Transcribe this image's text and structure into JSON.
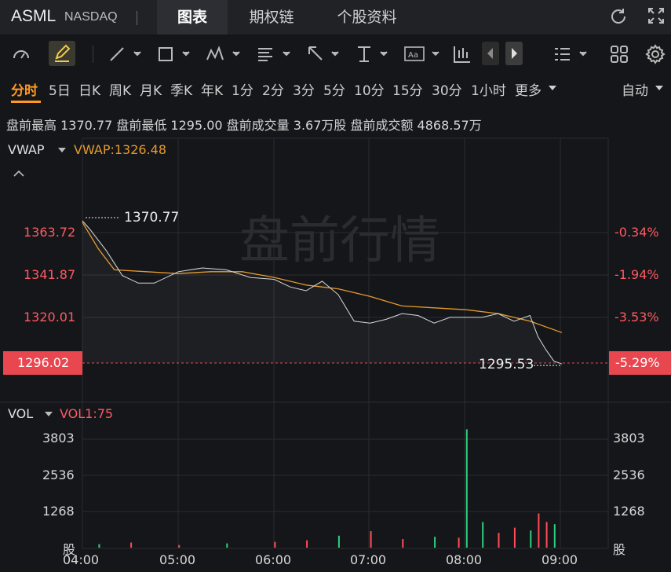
{
  "header": {
    "symbol": "ASML",
    "exchange": "NASDAQ",
    "tabs": [
      "图表",
      "期权链",
      "个股资料"
    ],
    "active_tab": "图表"
  },
  "periods": {
    "items": [
      "分时",
      "5日",
      "日K",
      "周K",
      "月K",
      "季K",
      "年K",
      "1分",
      "2分",
      "3分",
      "5分",
      "10分",
      "15分",
      "30分",
      "1小时",
      "更多"
    ],
    "active": "分时",
    "mode": "自动"
  },
  "stats": {
    "text": "盘前最高 1370.77 盘前最低 1295.00 盘前成交量 3.67万股 盘前成交额 4868.57万"
  },
  "price_panel": {
    "indicator": "VWAP",
    "indicator_value": "VWAP:1326.48",
    "watermark": "盘前行情",
    "left_ticks": [
      "1363.72",
      "1341.87",
      "1320.01"
    ],
    "right_ticks": [
      "-0.34%",
      "-1.94%",
      "-3.53%"
    ],
    "current_price": "1296.02",
    "current_pct": "-5.29%",
    "high_label": "1370.77",
    "low_label": "1295.53"
  },
  "volume_panel": {
    "indicator": "VOL",
    "indicator_value": "VOL1:75",
    "ticks": [
      "3803",
      "2536",
      "1268"
    ],
    "unit": "股"
  },
  "time_axis": [
    "04:00",
    "05:00",
    "06:00",
    "07:00",
    "08:00",
    "09:00"
  ],
  "colors": {
    "up": "#2fd07f",
    "down": "#ff4d56",
    "vwap": "#e59a2a",
    "price_line": "#d9d9d9",
    "accent": "#ff9a1f",
    "price_tag": "#e8474f"
  },
  "chart_data": {
    "type": "line",
    "x_range": [
      "04:00",
      "09:00"
    ],
    "series": [
      {
        "name": "VWAP",
        "x": [
          "04:00",
          "04:10",
          "04:20",
          "04:40",
          "05:00",
          "05:20",
          "05:40",
          "06:00",
          "06:20",
          "06:40",
          "07:00",
          "07:20",
          "07:40",
          "08:00",
          "08:20",
          "08:40",
          "09:00"
        ],
        "values": [
          1370,
          1356,
          1345,
          1344,
          1343,
          1344,
          1344,
          1341,
          1337,
          1335,
          1331,
          1326,
          1325,
          1324,
          1322,
          1318,
          1312
        ]
      },
      {
        "name": "Price",
        "x": [
          "04:00",
          "04:05",
          "04:15",
          "04:25",
          "04:35",
          "04:45",
          "05:00",
          "05:15",
          "05:30",
          "05:45",
          "06:00",
          "06:10",
          "06:20",
          "06:30",
          "06:40",
          "06:50",
          "07:00",
          "07:10",
          "07:20",
          "07:30",
          "07:40",
          "07:50",
          "08:00",
          "08:10",
          "08:20",
          "08:30",
          "08:40",
          "08:45",
          "08:50",
          "08:55",
          "09:00"
        ],
        "values": [
          1370.77,
          1366,
          1355,
          1342,
          1338,
          1338,
          1344,
          1346,
          1345,
          1341,
          1340,
          1336,
          1334,
          1339,
          1332,
          1318,
          1317,
          1319,
          1322,
          1321,
          1317,
          1320,
          1320,
          1320,
          1322,
          1318,
          1321,
          1310,
          1303,
          1297,
          1295.53
        ]
      }
    ],
    "ylim": [
      1296.02,
      1370.77
    ],
    "volume": {
      "ylim": [
        0,
        3803
      ],
      "x": [
        "04:10",
        "04:30",
        "05:00",
        "05:30",
        "06:00",
        "06:20",
        "06:40",
        "07:00",
        "07:20",
        "07:40",
        "07:55",
        "08:00",
        "08:10",
        "08:20",
        "08:30",
        "08:40",
        "08:45",
        "08:50",
        "08:55"
      ],
      "values": [
        120,
        180,
        90,
        150,
        200,
        260,
        420,
        580,
        300,
        380,
        350,
        4150,
        900,
        520,
        700,
        600,
        1200,
        900,
        820
      ]
    }
  }
}
